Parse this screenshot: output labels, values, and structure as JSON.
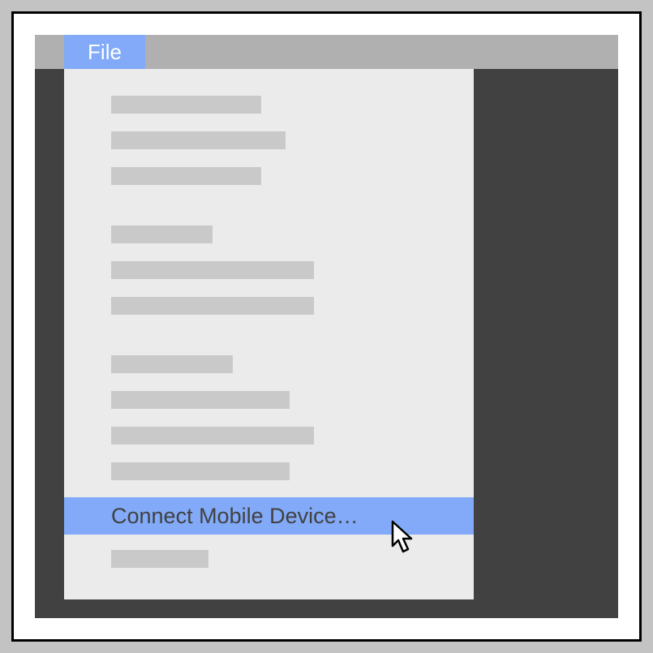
{
  "menu_bar": {
    "file_label": "File"
  },
  "dropdown": {
    "highlighted_label": "Connect Mobile Device…"
  },
  "placeholder_widths": {
    "g1_1": 185,
    "g1_2": 215,
    "g1_3": 185,
    "g2_1": 125,
    "g2_2": 250,
    "g2_3": 250,
    "g3_1": 150,
    "g3_2": 220,
    "g3_3": 250,
    "g3_4": 220,
    "g4_1": 120
  }
}
